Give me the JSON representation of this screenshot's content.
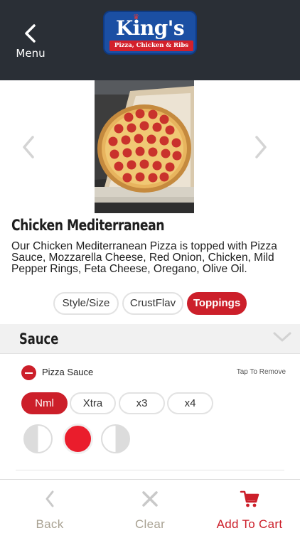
{
  "header": {
    "menu_label": "Menu",
    "logo_brand": "King's",
    "logo_tagline": "Pizza, Chicken & Ribs"
  },
  "product": {
    "name": "Chicken Mediterranean",
    "description": "Our Chicken Mediterranean Pizza is topped with Pizza Sauce, Mozzarella Cheese, Red Onion, Chicken, Mild Pepper Rings, Feta Cheese, Oregano, Olive Oil."
  },
  "tabs": [
    {
      "label": "Style/Size",
      "active": false
    },
    {
      "label": "CrustFlav",
      "active": false
    },
    {
      "label": "Toppings",
      "active": true
    }
  ],
  "section": {
    "title": "Sauce",
    "item": {
      "name": "Pizza Sauce",
      "tap_hint": "Tap To Remove"
    },
    "amounts": [
      {
        "label": "Nml",
        "selected": true
      },
      {
        "label": "Xtra",
        "selected": false
      },
      {
        "label": "x3",
        "selected": false
      },
      {
        "label": "x4",
        "selected": false
      }
    ],
    "coverage_selected": "whole"
  },
  "bottom_bar": {
    "back_label": "Back",
    "clear_label": "Clear",
    "cart_label": "Add To Cart"
  },
  "colors": {
    "header_bg": "#2a2f36",
    "accent_red": "#cc1f2a",
    "muted_label": "#a9a293"
  },
  "icons": {
    "menu": "chevron-left-icon",
    "prev": "chevron-left-icon",
    "next": "chevron-right-icon",
    "section_toggle": "chevron-down-icon",
    "back": "chevron-left-icon",
    "clear": "close-icon",
    "cart": "cart-icon"
  }
}
